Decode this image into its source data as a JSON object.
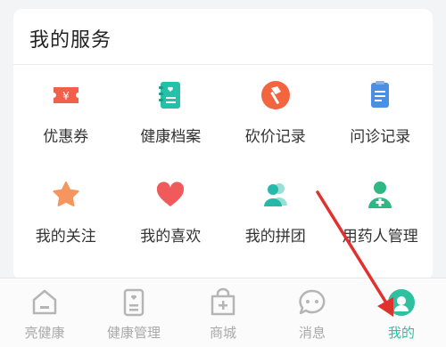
{
  "section": {
    "title": "我的服务"
  },
  "services": [
    {
      "label": "优惠券",
      "icon": "coupon-icon",
      "color": "#f0604a"
    },
    {
      "label": "健康档案",
      "icon": "health-record-icon",
      "color": "#22c1a8"
    },
    {
      "label": "砍价记录",
      "icon": "bargain-axe-icon",
      "color": "#f2653f"
    },
    {
      "label": "问诊记录",
      "icon": "consult-record-icon",
      "color": "#4a8fe6"
    },
    {
      "label": "我的关注",
      "icon": "star-icon",
      "color": "#f6965e"
    },
    {
      "label": "我的喜欢",
      "icon": "heart-icon",
      "color": "#f05a5a"
    },
    {
      "label": "我的拼团",
      "icon": "group-users-icon",
      "color": "#26b8a8"
    },
    {
      "label": "用药人管理",
      "icon": "medication-user-icon",
      "color": "#2db884"
    }
  ],
  "tabbar": {
    "tabs": [
      {
        "label": "亮健康",
        "icon": "home-icon"
      },
      {
        "label": "健康管理",
        "icon": "health-manage-icon"
      },
      {
        "label": "商城",
        "icon": "mall-icon"
      },
      {
        "label": "消息",
        "icon": "message-icon"
      },
      {
        "label": "我的",
        "icon": "profile-icon",
        "active": true
      }
    ]
  },
  "colors": {
    "accent": "#2fbfa1",
    "annotation_arrow": "#e0312e",
    "inactive": "#a9a9a9"
  }
}
